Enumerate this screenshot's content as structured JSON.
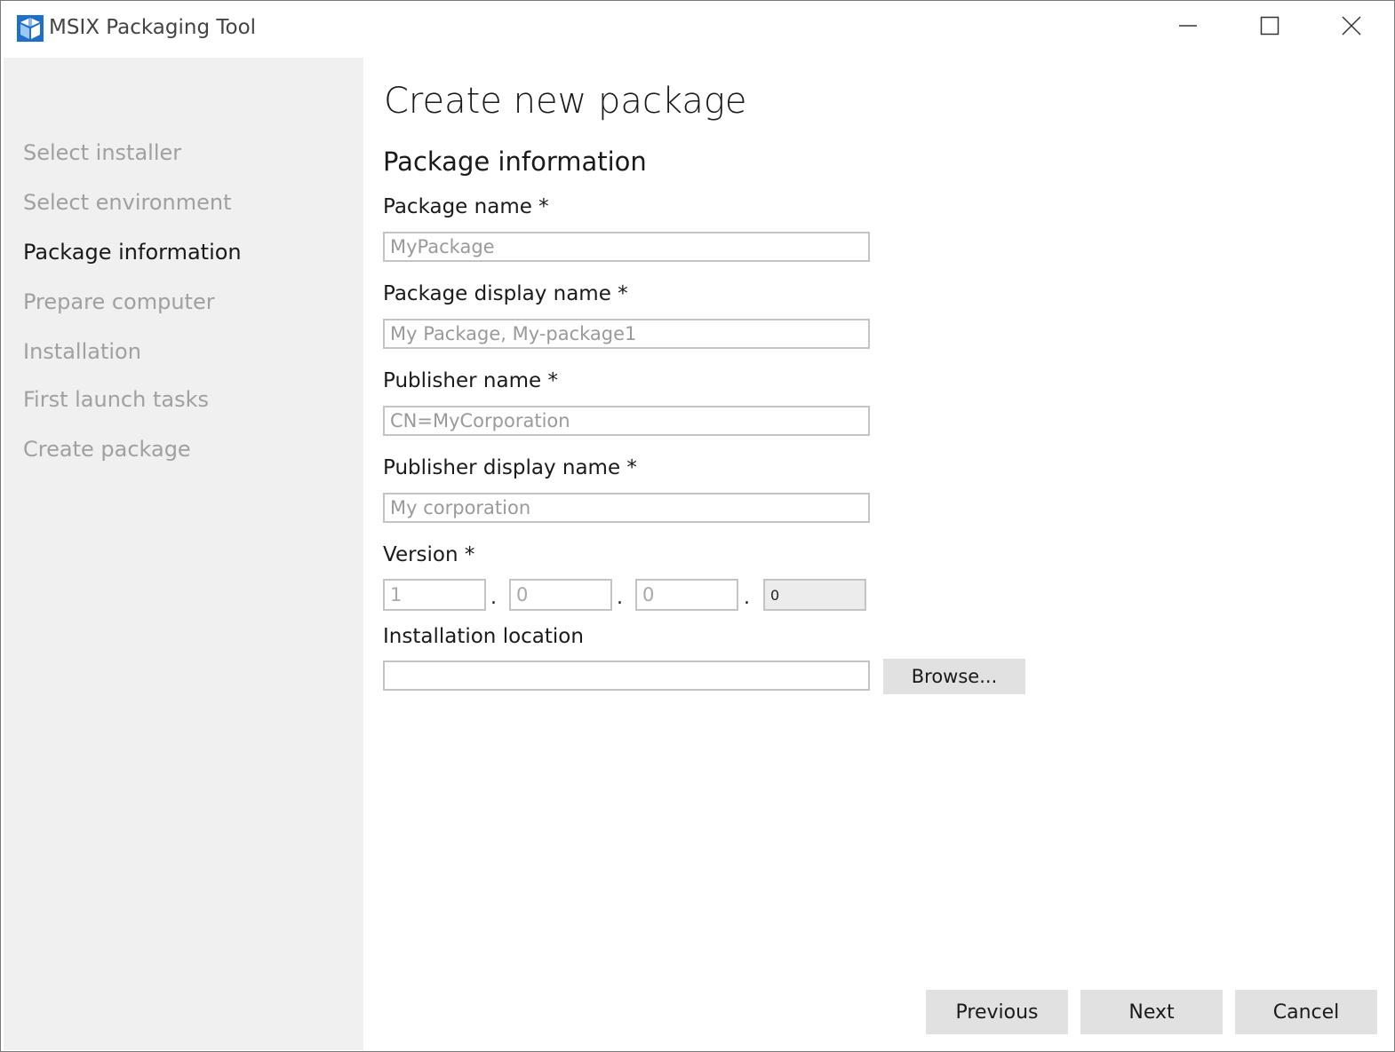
{
  "window": {
    "title": "MSIX Packaging Tool"
  },
  "sidebar": {
    "steps": [
      {
        "label": "Select installer",
        "state": "inactive"
      },
      {
        "label": "Select environment",
        "state": "inactive"
      },
      {
        "label": "Package information",
        "state": "active"
      },
      {
        "label": "Prepare computer",
        "state": "inactive"
      },
      {
        "label": "Installation",
        "state": "inactive"
      },
      {
        "label": "First launch tasks",
        "state": "inactive"
      },
      {
        "label": "Create package",
        "state": "inactive"
      }
    ]
  },
  "main": {
    "page_title": "Create new package",
    "section_title": "Package information",
    "fields": {
      "package_name": {
        "label": "Package name *",
        "placeholder": "MyPackage",
        "value": ""
      },
      "package_display_name": {
        "label": "Package display name *",
        "placeholder": "My Package, My-package1",
        "value": ""
      },
      "publisher_name": {
        "label": "Publisher name *",
        "placeholder": "CN=MyCorporation",
        "value": ""
      },
      "publisher_display_name": {
        "label": "Publisher display name *",
        "placeholder": "My corporation",
        "value": ""
      },
      "version": {
        "label": "Version *",
        "separator": ".",
        "parts": [
          {
            "placeholder": "1"
          },
          {
            "placeholder": "0"
          },
          {
            "placeholder": "0"
          },
          {
            "value": "0",
            "disabled": true
          }
        ]
      },
      "installation_location": {
        "label": "Installation location",
        "value": ""
      }
    },
    "browse_label": "Browse..."
  },
  "footer": {
    "previous_label": "Previous",
    "next_label": "Next",
    "cancel_label": "Cancel"
  },
  "colors": {
    "sidebar_bg": "#f0f0f0",
    "active_step": "#1a1a1a",
    "inactive_step": "#a0a0a0",
    "button_bg": "#e1e1e1",
    "input_border": "#c4c4c4",
    "icon_blue": "#1e6fc8"
  },
  "icons": {
    "app": "msix-package-box-icon",
    "minimize": "minimize-icon",
    "maximize": "maximize-icon",
    "close": "close-icon"
  }
}
